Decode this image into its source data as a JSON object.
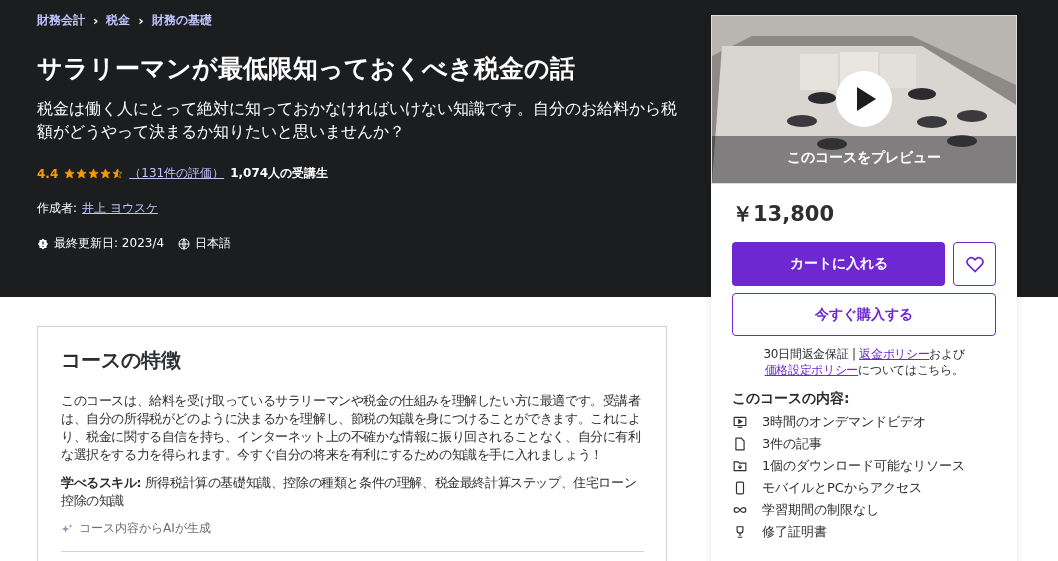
{
  "breadcrumbs": [
    {
      "label": "財務会計"
    },
    {
      "label": "税金"
    },
    {
      "label": "財務の基礎"
    }
  ],
  "breadcrumb_separator": "›",
  "title": "サラリーマンが最低限知っておくべき税金の話",
  "subtitle": "税金は働く人にとって絶対に知っておかなければいけない知識です。自分のお給料から税額がどうやって決まるか知りたいと思いませんか？",
  "rating": {
    "score": "4.4",
    "stars": 4.5,
    "reviews": "（131件の評価）",
    "students": "1,074人の受講生"
  },
  "author": {
    "label": "作成者:",
    "name": "井上 ヨウスケ"
  },
  "meta": {
    "updated": "最終更新日: 2023/4",
    "language": "日本語"
  },
  "features": {
    "heading": "コースの特徴",
    "body": "このコースは、給料を受け取っているサラリーマンや税金の仕組みを理解したい方に最適です。受講者は、自分の所得税がどのように決まるかを理解し、節税の知識を身につけることができます。これにより、税金に関する自信を持ち、インターネット上の不確かな情報に振り回されることなく、自分に有利な選択をする力を得られます。今すぐ自分の将来を有利にするための知識を手に入れましょう！",
    "skills": "**学べるスキル:** 所得税計算の基礎知識、控除の種類と条件の理解、税金最終計算ステップ、住宅ローン控除の知識",
    "ai_note": "コース内容からAIが生成"
  },
  "sidebar": {
    "preview": {
      "kind": "picture",
      "label": "このコースをプレビュー"
    },
    "price": "￥13,800",
    "add_to_cart": "カートに入れる",
    "wishlisted": false,
    "buy_now": "今すぐ購入する",
    "guarantee": {
      "prefix": "30日間返金保証 | ",
      "link1": "返金ポリシー",
      "middle": "および",
      "link2": "価格設定ポリシー",
      "suffix": "についてはこちら。"
    },
    "includes_heading": "このコースの内容:",
    "includes": [
      {
        "kind": "video",
        "text": "3時間のオンデマンドビデオ"
      },
      {
        "kind": "article",
        "text": "3件の記事"
      },
      {
        "kind": "download",
        "text": "1個のダウンロード可能なリソース"
      },
      {
        "kind": "mobile",
        "text": "モバイルとPCからアクセス"
      },
      {
        "kind": "infinity",
        "text": "学習期間の制限なし"
      },
      {
        "kind": "certificate",
        "text": "修了証明書"
      }
    ]
  }
}
